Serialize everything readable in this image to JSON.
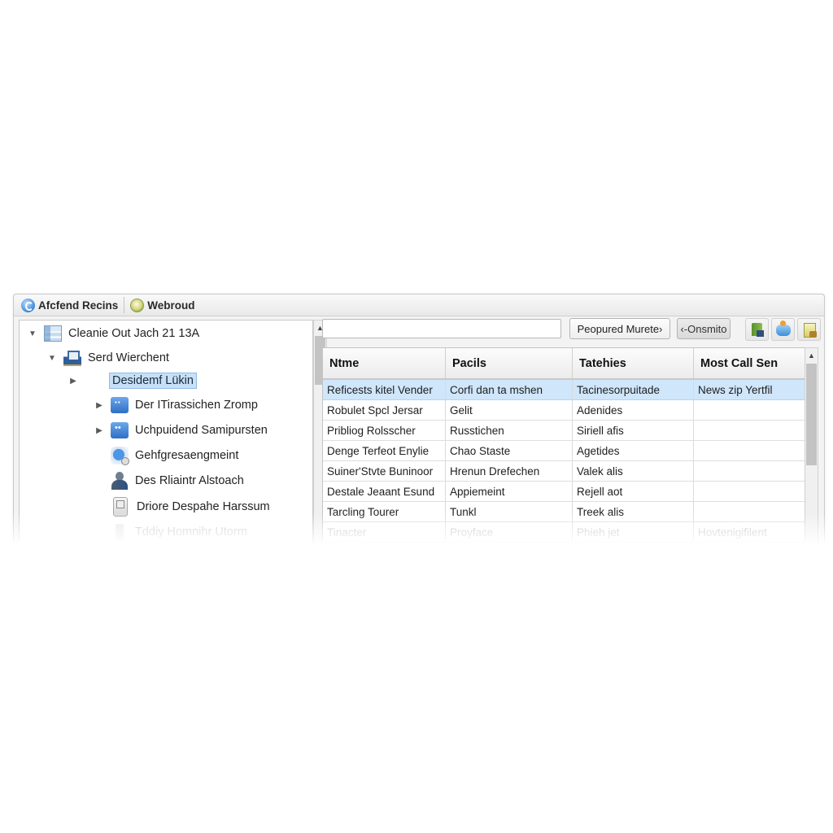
{
  "tabs": [
    {
      "label": "Afcfend Recins",
      "icon": "refresh-globe-icon"
    },
    {
      "label": "Webroud",
      "icon": "web-globe-icon"
    }
  ],
  "tree": {
    "items": [
      {
        "label": "Cleanie Out Jach 21 13A",
        "level": 0,
        "expander": "expanded",
        "icon": "list-window-icon"
      },
      {
        "label": "Serd Wierchent",
        "level": 1,
        "expander": "expanded",
        "icon": "machine-icon"
      },
      {
        "label": "Desidemf Lükin",
        "level": 2,
        "expander": "collapsed",
        "icon": "window-icon",
        "selected": true
      },
      {
        "label": "Der ITirassichen Zromp",
        "level": 3,
        "expander": "collapsed",
        "icon": "blue-box-icon"
      },
      {
        "label": "Uchpuidend Samipursten",
        "level": 3,
        "expander": "collapsed",
        "icon": "chat-icon"
      },
      {
        "label": "Gehfgresaengmeint",
        "level": 3,
        "expander": "none",
        "icon": "globe-icon"
      },
      {
        "label": "Des Rliaintr Alstoach",
        "level": 3,
        "expander": "none",
        "icon": "person-icon"
      },
      {
        "label": "Driore Despahe Harssum",
        "level": 3,
        "expander": "none",
        "icon": "device-icon"
      },
      {
        "label": "Tddiy Homnihr Utorm",
        "level": 3,
        "expander": "none",
        "icon": "upload-icon",
        "faded": true
      }
    ]
  },
  "toolbar": {
    "search_value": "",
    "prepared_button": "Peopured Murete›",
    "common_button": "‹-Onsmito",
    "icon_buttons": [
      "export-icon",
      "connect-icon",
      "package-icon"
    ]
  },
  "grid": {
    "columns": [
      "Ntme",
      "Pacils",
      "Tatehies",
      "Most Call Sen"
    ],
    "rows": [
      {
        "cells": [
          "Reficests kitel Vender",
          "Corfi dan ta mshen",
          "Tacinesorpuitade",
          "News zip Yertfil"
        ],
        "selected": true
      },
      {
        "cells": [
          "Robulet Spcl Jersar",
          "Gelit",
          "Adenides",
          ""
        ]
      },
      {
        "cells": [
          "Pribliog Rolsscher",
          "Russtichen",
          "Siriell afis",
          ""
        ]
      },
      {
        "cells": [
          "Denge Terfeot Enylie",
          "Chao Staste",
          "Agetides",
          ""
        ]
      },
      {
        "cells": [
          "Suiner'Stvte Buninoor",
          "Hrenun Drefechen",
          "Valek alis",
          ""
        ]
      },
      {
        "cells": [
          "Destale Jeaant Esund",
          "Appiemeint",
          "Rejell aot",
          ""
        ]
      },
      {
        "cells": [
          "Tarcling Tourer",
          "Tunkl",
          "Treek alis",
          ""
        ]
      },
      {
        "cells": [
          "Tinacter",
          "Proyface",
          "Phieh jet",
          "Hovtenigifilent"
        ],
        "faded": true
      }
    ]
  }
}
